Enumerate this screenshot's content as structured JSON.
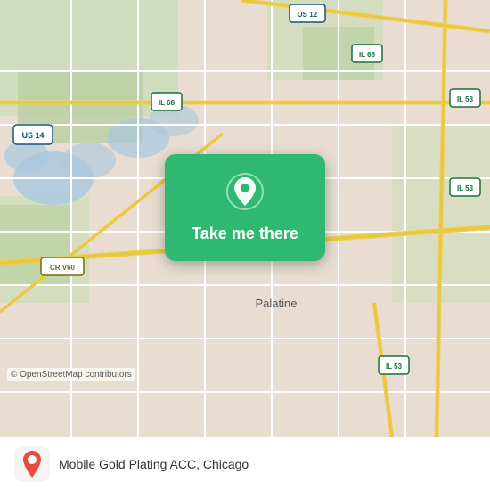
{
  "map": {
    "attribution": "© OpenStreetMap contributors",
    "city": "Palatine",
    "background_color": "#e8ddd0"
  },
  "card": {
    "button_label": "Take me there",
    "icon": "location-pin"
  },
  "bottom_bar": {
    "place_name": "Mobile Gold Plating ACC, Chicago",
    "logo_alt": "moovit"
  },
  "roads": {
    "us14_label": "US 14",
    "il68_label": "IL 68",
    "il53_label": "IL 53",
    "us12_label": "US 12",
    "crv60_label": "CR V60"
  }
}
